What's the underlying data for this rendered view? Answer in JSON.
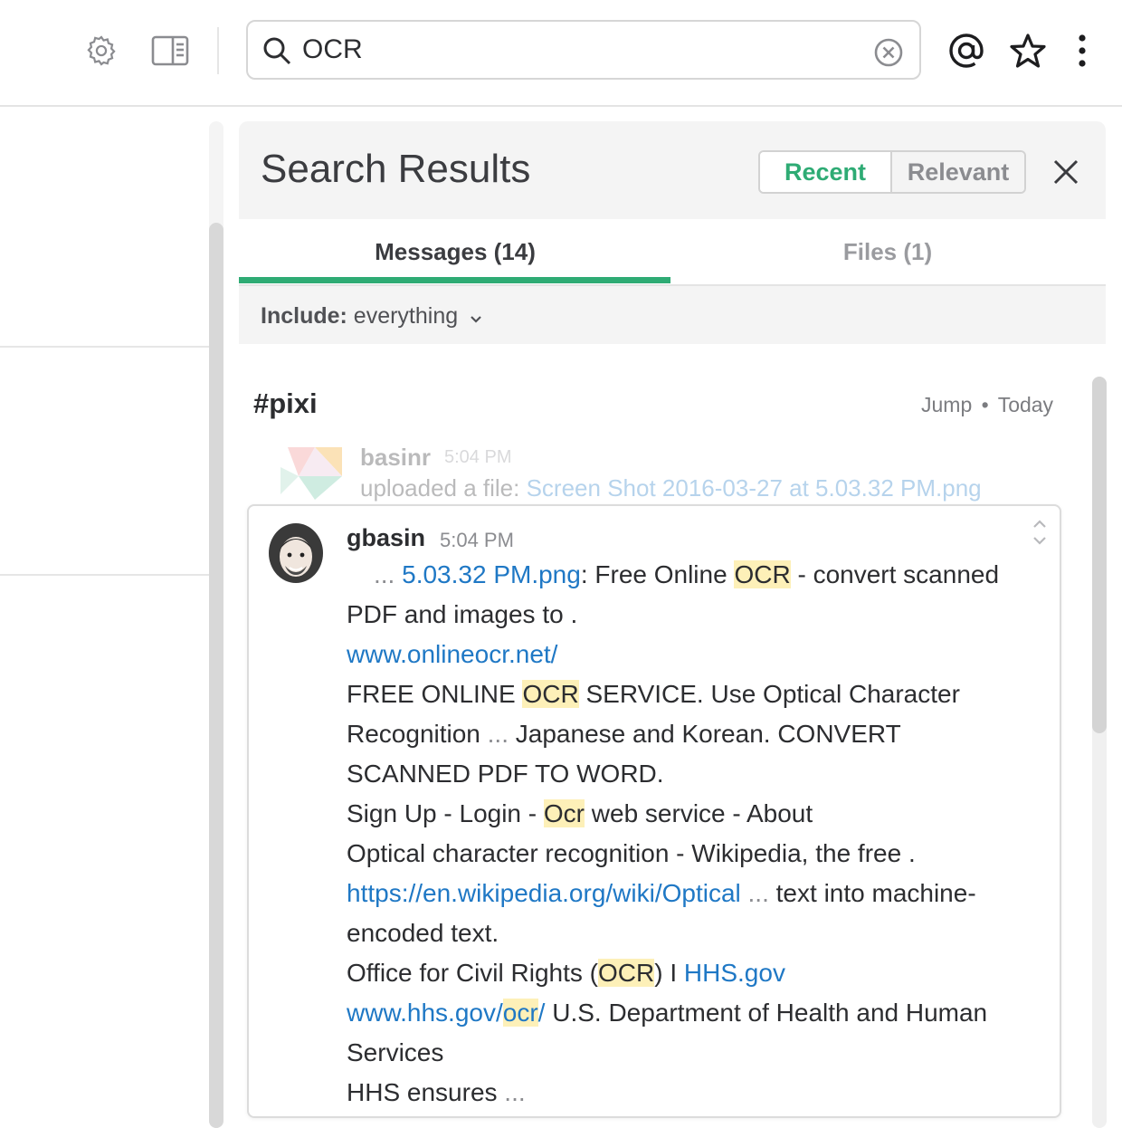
{
  "search": {
    "query": "OCR"
  },
  "panel": {
    "title": "Search Results",
    "sort_recent": "Recent",
    "sort_relevant": "Relevant"
  },
  "tabs": {
    "messages": "Messages (14)",
    "files": "Files (1)"
  },
  "include": {
    "label": "Include:",
    "value": "everything"
  },
  "channel": {
    "name": "#pixi",
    "jump": "Jump",
    "separator": "•",
    "date": "Today"
  },
  "faded_message": {
    "user": "basinr",
    "time": "5:04 PM",
    "prefix": "uploaded a file: ",
    "file_link": "Screen Shot 2016-03-27 at 5.03.32 PM.png"
  },
  "message": {
    "user": "gbasin",
    "time": "5:04 PM",
    "l1_ellipsis": "...",
    "l1_link": "5.03.32 PM.png",
    "l1_text": ": Free Online ",
    "l1_hl": "OCR",
    "l1_rest": " - convert scanned",
    "l2": "PDF and images to .",
    "l3_link": "www.onlineocr.net/",
    "l4_a": "FREE ONLINE ",
    "l4_hl": "OCR",
    "l4_b": " SERVICE. Use Optical Character",
    "l5_a": "Recognition ",
    "l5_ell": "...",
    "l5_b": " Japanese and Korean. CONVERT",
    "l6": "SCANNED PDF TO WORD.",
    "l7_a": "Sign Up - Login - ",
    "l7_hl": "Ocr",
    "l7_b": " web service - About",
    "l8": "Optical character recognition - Wikipedia, the free .",
    "l9_link": "https://en.wikipedia.org/wiki/Optical",
    "l9_ell": " ...",
    "l9_b": " text into machine-",
    "l10": "encoded text.",
    "l11_a": "Office for Civil Rights (",
    "l11_hl": "OCR",
    "l11_b": ") I ",
    "l11_link": "HHS.gov",
    "l12_link_a": "www.hhs.gov/",
    "l12_hl": "ocr",
    "l12_link_b": "/",
    "l12_b": " U.S. Department of Health and Human",
    "l13": "Services",
    "l14_a": "HHS ensures ",
    "l14_ell": "..."
  },
  "colors": {
    "accent_green": "#2eab74",
    "link_blue": "#1f78c5",
    "highlight": "#fdf0b8"
  },
  "icons": [
    "gear-icon",
    "sidebar-toggle-icon",
    "search-icon",
    "clear-icon",
    "mention-icon",
    "star-icon",
    "more-vertical-icon",
    "close-icon",
    "chevron-down-icon",
    "updown-arrows-icon"
  ]
}
